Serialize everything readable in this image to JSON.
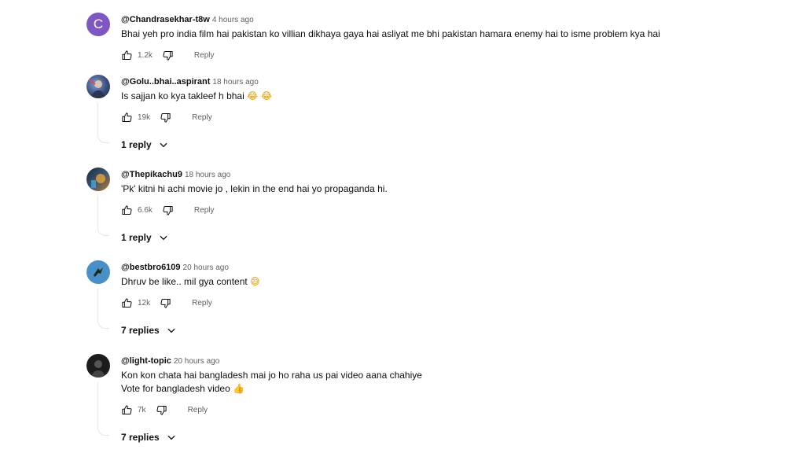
{
  "comments": [
    {
      "author": "@Chandrasekhar-t8w",
      "time": "4 hours ago",
      "lines": [
        "Bhai yeh pro india film hai pakistan ko villian dikhaya gaya hai asliyat me bhi pakistan hamara enemy hai to isme problem kya hai"
      ],
      "emoji": "",
      "likes": "1.2k",
      "reply_label": "Reply",
      "replies_label": "",
      "avatar_letter": "C",
      "avatar_color": "#7e57c2"
    },
    {
      "author": "@Golu..bhai..aspirant",
      "time": "18 hours ago",
      "lines": [
        "Is sajjan ko kya takleef h bhai"
      ],
      "emoji": "😂 😂",
      "likes": "19k",
      "reply_label": "Reply",
      "replies_label": "1 reply",
      "avatar_letter": "",
      "avatar_color": "#3a4d7a"
    },
    {
      "author": "@Thepikachu9",
      "time": "18 hours ago",
      "lines": [
        "'Pk' kitni hi achi movie jo , lekin in the end hai yo propaganda hi."
      ],
      "emoji": "",
      "likes": "6.6k",
      "reply_label": "Reply",
      "replies_label": "1 reply",
      "avatar_letter": "",
      "avatar_color": "#2b3a4a"
    },
    {
      "author": "@bestbro6109",
      "time": "20 hours ago",
      "lines": [
        "Dhruv be like.. mil gya content"
      ],
      "emoji": "😅",
      "likes": "12k",
      "reply_label": "Reply",
      "replies_label": "7 replies",
      "avatar_letter": "",
      "avatar_color": "#4a90c8"
    },
    {
      "author": "@light-topic",
      "time": "20 hours ago",
      "lines": [
        "Kon kon chata hai bangladesh mai jo ho raha us pai video aana chahiye",
        "Vote for bangladesh video"
      ],
      "emoji": "👍",
      "likes": "7k",
      "reply_label": "Reply",
      "replies_label": "7 replies",
      "avatar_letter": "",
      "avatar_color": "#1c1c1c"
    }
  ]
}
